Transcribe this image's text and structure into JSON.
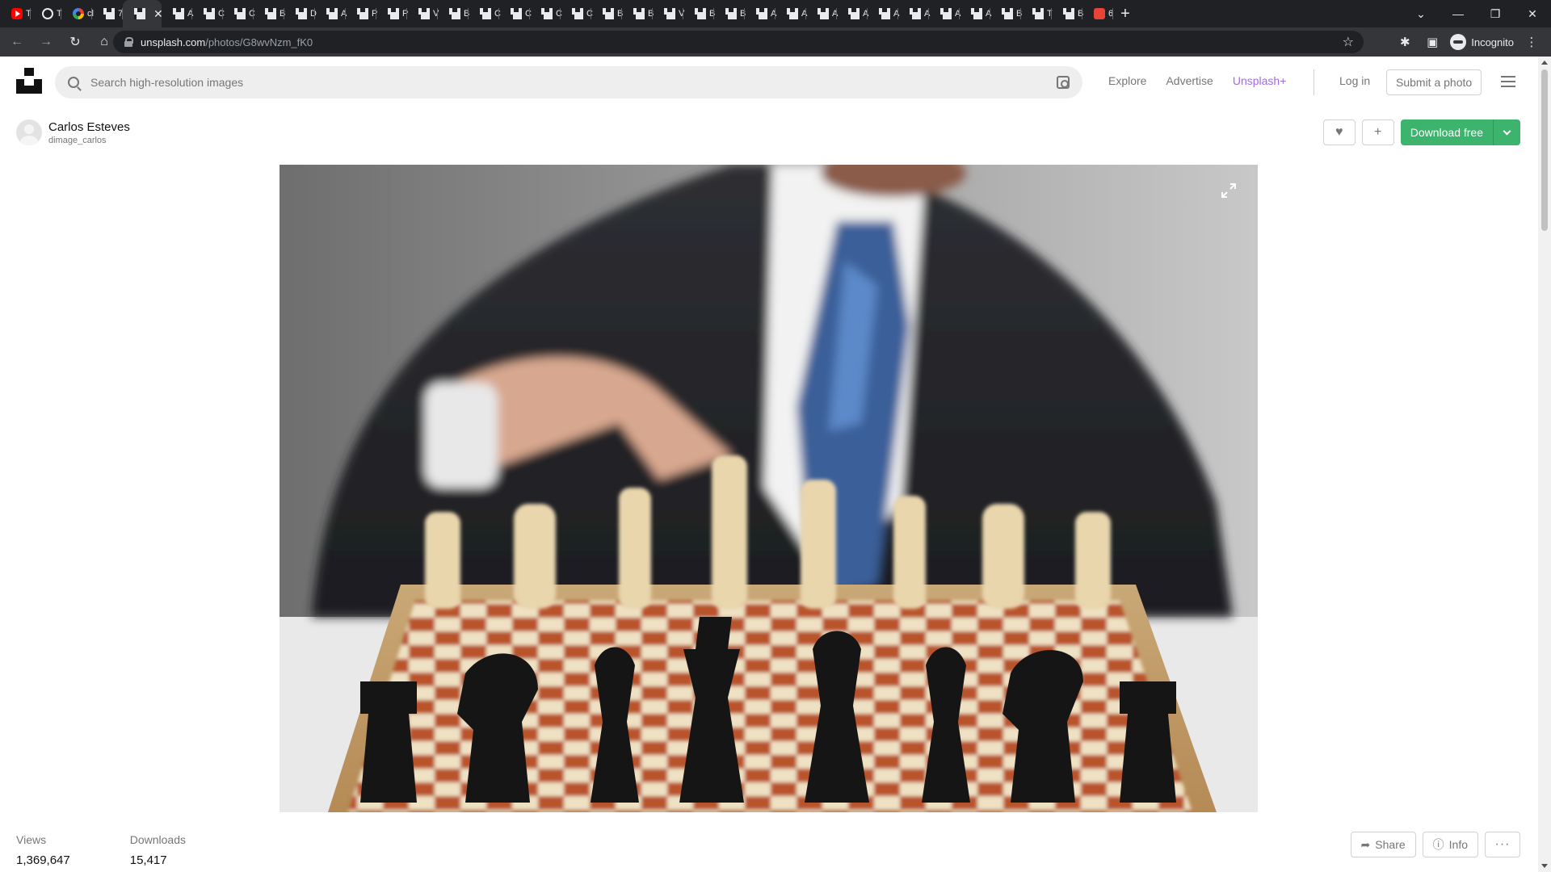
{
  "browser": {
    "tabs": [
      {
        "icon": "youtube-favicon",
        "label": "T"
      },
      {
        "icon": "globe-favicon",
        "label": "T"
      },
      {
        "icon": "google-favicon",
        "label": "cl"
      },
      {
        "icon": "unsplash-favicon",
        "label": "7"
      },
      {
        "icon": "unsplash-favicon",
        "label": "",
        "active": true
      },
      {
        "icon": "unsplash-favicon",
        "label": "A"
      },
      {
        "icon": "unsplash-favicon",
        "label": "C"
      },
      {
        "icon": "unsplash-favicon",
        "label": "C"
      },
      {
        "icon": "unsplash-favicon",
        "label": "B"
      },
      {
        "icon": "unsplash-favicon",
        "label": "D"
      },
      {
        "icon": "unsplash-favicon",
        "label": "A"
      },
      {
        "icon": "unsplash-favicon",
        "label": "P"
      },
      {
        "icon": "unsplash-favicon",
        "label": "P"
      },
      {
        "icon": "unsplash-favicon",
        "label": "V"
      },
      {
        "icon": "unsplash-favicon",
        "label": "B"
      },
      {
        "icon": "unsplash-favicon",
        "label": "C"
      },
      {
        "icon": "unsplash-favicon",
        "label": "C"
      },
      {
        "icon": "unsplash-favicon",
        "label": "C"
      },
      {
        "icon": "unsplash-favicon",
        "label": "C"
      },
      {
        "icon": "unsplash-favicon",
        "label": "B"
      },
      {
        "icon": "unsplash-favicon",
        "label": "B"
      },
      {
        "icon": "unsplash-favicon",
        "label": "V"
      },
      {
        "icon": "unsplash-favicon",
        "label": "B"
      },
      {
        "icon": "unsplash-favicon",
        "label": "B"
      },
      {
        "icon": "unsplash-favicon",
        "label": "A"
      },
      {
        "icon": "unsplash-favicon",
        "label": "A"
      },
      {
        "icon": "unsplash-favicon",
        "label": "A"
      },
      {
        "icon": "unsplash-favicon",
        "label": "A"
      },
      {
        "icon": "unsplash-favicon",
        "label": "A"
      },
      {
        "icon": "unsplash-favicon",
        "label": "A"
      },
      {
        "icon": "unsplash-favicon",
        "label": "A"
      },
      {
        "icon": "unsplash-favicon",
        "label": "A"
      },
      {
        "icon": "unsplash-favicon",
        "label": "B"
      },
      {
        "icon": "unsplash-favicon",
        "label": "T"
      },
      {
        "icon": "unsplash-favicon",
        "label": "B"
      },
      {
        "icon": "red-app-favicon",
        "label": "6"
      }
    ],
    "url_host": "unsplash.com",
    "url_path": "/photos/G8wvNzm_fK0",
    "profile_label": "Incognito"
  },
  "header": {
    "search_placeholder": "Search high-resolution images",
    "nav": [
      "Explore",
      "Advertise",
      "Unsplash+"
    ],
    "login": "Log in",
    "submit": "Submit a photo"
  },
  "author": {
    "name": "Carlos Esteves",
    "handle": "dimage_carlos"
  },
  "actions": {
    "download": "Download free"
  },
  "stats": {
    "views_label": "Views",
    "views_value": "1,369,647",
    "downloads_label": "Downloads",
    "downloads_value": "15,417"
  },
  "bottom_actions": {
    "share": "Share",
    "info": "Info"
  },
  "colors": {
    "accent_green": "#3cb46e",
    "unsplash_plus": "#a16be8",
    "chrome_dark": "#202124"
  }
}
